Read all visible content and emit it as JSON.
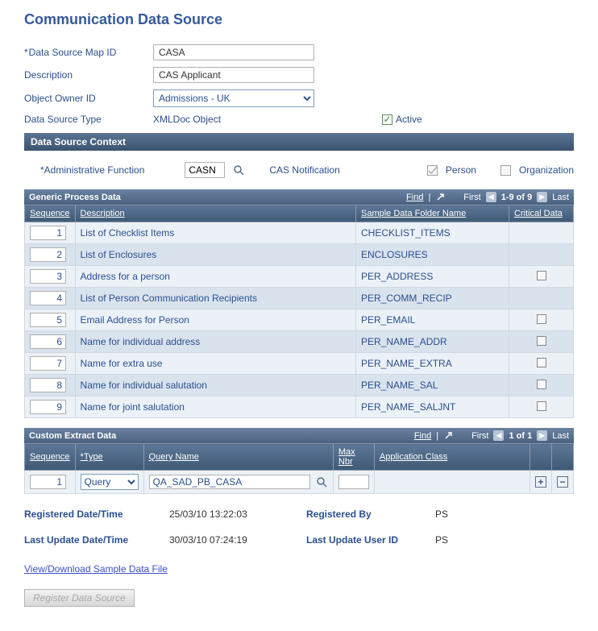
{
  "title": "Communication Data Source",
  "fields": {
    "map_id_label": "Data Source Map ID",
    "map_id_value": "CASA",
    "desc_label": "Description",
    "desc_value": "CAS Applicant",
    "owner_label": "Object Owner ID",
    "owner_value": "Admissions - UK",
    "type_label": "Data Source Type",
    "type_value": "XMLDoc Object",
    "active_label": "Active"
  },
  "context": {
    "bar": "Data Source Context",
    "admin_label": "Administrative Function",
    "admin_value": "CASN",
    "admin_desc": "CAS Notification",
    "person": "Person",
    "org": "Organization"
  },
  "generic": {
    "title": "Generic Process Data",
    "find": "Find",
    "range": "1-9 of 9",
    "first": "First",
    "last": "Last",
    "cols": {
      "seq": "Sequence",
      "desc": "Description",
      "folder": "Sample Data Folder Name",
      "crit": "Critical Data"
    },
    "rows": [
      {
        "seq": "1",
        "desc": "List of Checklist Items",
        "folder": "CHECKLIST_ITEMS",
        "crit": null
      },
      {
        "seq": "2",
        "desc": "List of Enclosures",
        "folder": "ENCLOSURES",
        "crit": null
      },
      {
        "seq": "3",
        "desc": "Address for a person",
        "folder": "PER_ADDRESS",
        "crit": false
      },
      {
        "seq": "4",
        "desc": "List of Person Communication Recipients",
        "folder": "PER_COMM_RECIP",
        "crit": null
      },
      {
        "seq": "5",
        "desc": "Email Address for Person",
        "folder": "PER_EMAIL",
        "crit": false
      },
      {
        "seq": "6",
        "desc": "Name for individual address",
        "folder": "PER_NAME_ADDR",
        "crit": false
      },
      {
        "seq": "7",
        "desc": "Name for extra use",
        "folder": "PER_NAME_EXTRA",
        "crit": false
      },
      {
        "seq": "8",
        "desc": "Name for individual salutation",
        "folder": "PER_NAME_SAL",
        "crit": false
      },
      {
        "seq": "9",
        "desc": "Name for joint salutation",
        "folder": "PER_NAME_SALJNT",
        "crit": false
      }
    ]
  },
  "custom": {
    "title": "Custom Extract Data",
    "find": "Find",
    "range": "1 of 1",
    "first": "First",
    "last": "Last",
    "cols": {
      "seq": "Sequence",
      "type": "*Type",
      "qname": "Query Name",
      "max": "Max Nbr",
      "appclass": "Application Class"
    },
    "row": {
      "seq": "1",
      "type": "Query",
      "qname": "QA_SAD_PB_CASA",
      "max": "",
      "appclass": ""
    }
  },
  "audit": {
    "reg_label": "Registered Date/Time",
    "reg_val": "25/03/10 13:22:03",
    "regby_label": "Registered By",
    "regby_val": "PS",
    "upd_label": "Last Update Date/Time",
    "upd_val": "30/03/10 07:24:19",
    "updby_label": "Last Update User ID",
    "updby_val": "PS"
  },
  "link": "View/Download Sample Data File",
  "button": "Register Data Source"
}
